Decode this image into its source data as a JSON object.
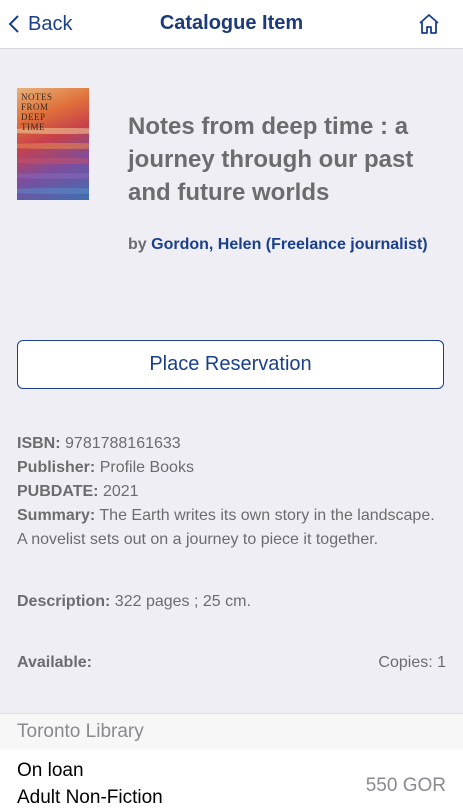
{
  "nav": {
    "back_label": "Back",
    "title": "Catalogue Item"
  },
  "book": {
    "cover_text": "NOTES FROM DEEP TIME",
    "title": "Notes from deep time : a journey through our past and future worlds",
    "by_prefix": "by",
    "author": "Gordon, Helen (Freelance journalist)"
  },
  "actions": {
    "reserve_label": "Place Reservation"
  },
  "details": {
    "isbn_label": "ISBN:",
    "isbn": "9781788161633",
    "publisher_label": "Publisher:",
    "publisher": "Profile Books",
    "pubdate_label": "PUBDATE:",
    "pubdate": "2021",
    "summary_label": "Summary:",
    "summary": "The Earth writes its own story in the landscape. A novelist sets out on a journey to piece it together.",
    "description_label": "Description:",
    "description": "322 pages ; 25 cm."
  },
  "availability": {
    "label": "Available:",
    "copies": "Copies: 1"
  },
  "holdings": {
    "library": "Toronto Library",
    "items": [
      {
        "status": "On loan",
        "collection": "Adult Non-Fiction",
        "call_number": "550 GOR"
      }
    ]
  },
  "colors": {
    "accent": "#1a3f8f",
    "text_secondary": "#6c6c70",
    "background": "#efeef4"
  }
}
